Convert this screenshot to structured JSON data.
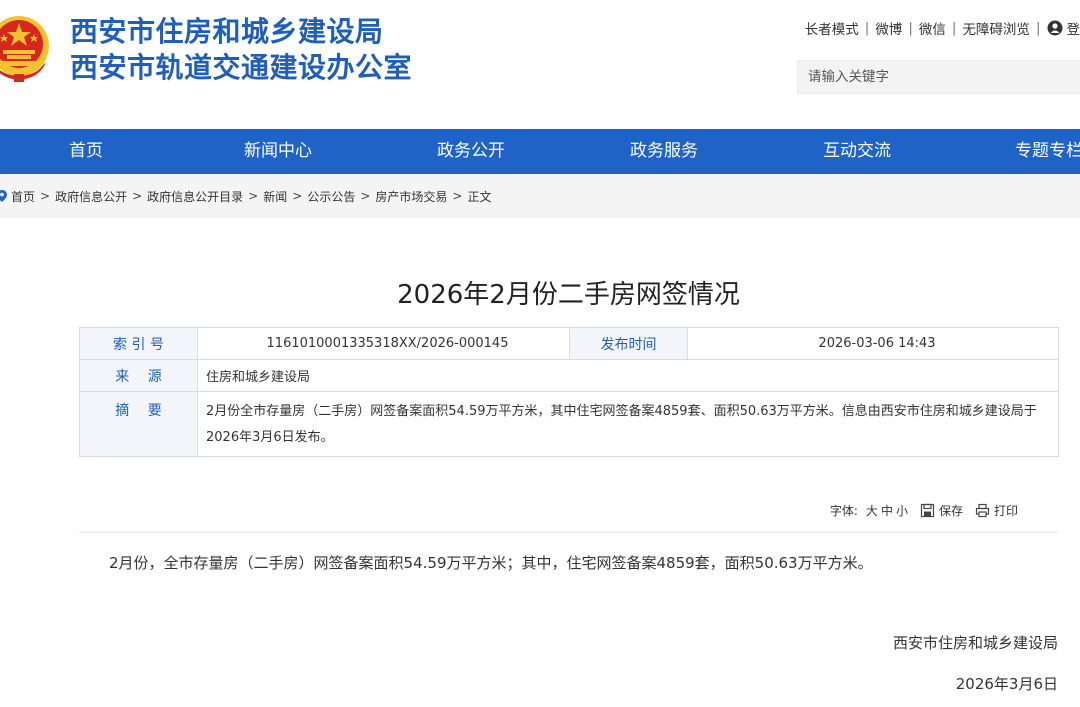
{
  "header": {
    "title_line1": "西安市住房和城乡建设局",
    "title_line2": "西安市轨道交通建设办公室",
    "top_links": [
      "长者模式",
      "微博",
      "微信",
      "无障碍浏览"
    ],
    "login_label": "登",
    "search_placeholder": "请输入关键字"
  },
  "nav": {
    "items": [
      "首页",
      "新闻中心",
      "政务公开",
      "政务服务",
      "互动交流",
      "专题专栏"
    ]
  },
  "breadcrumb": {
    "items": [
      "首页",
      "政府信息公开",
      "政府信息公开目录",
      "新闻",
      "公示公告",
      "房产市场交易",
      "正文"
    ],
    "separator": ">"
  },
  "article": {
    "title": "2026年2月份二手房网签情况",
    "meta": {
      "index_label": "索 引 号",
      "index_value": "1161010001335318XX/2026-000145",
      "publish_label": "发布时间",
      "publish_value": "2026-03-06 14:43",
      "source_label": "来　 源",
      "source_value": "住房和城乡建设局",
      "summary_label": "摘　 要",
      "summary_value": "2月份全市存量房（二手房）网签备案面积54.59万平方米，其中住宅网签备案4859套、面积50.63万平方米。信息由西安市住房和城乡建设局于2026年3月6日发布。"
    },
    "tools": {
      "font_label": "字体:",
      "font_sizes": [
        "大",
        "中",
        "小"
      ],
      "save_label": "保存",
      "print_label": "打印"
    },
    "body": "2月份，全市存量房（二手房）网签备案面积54.59万平方米；其中，住宅网签备案4859套，面积50.63万平方米。",
    "signature_org": "西安市住房和城乡建设局",
    "signature_date": "2026年3月6日"
  },
  "colors": {
    "brand_blue": "#1f63c6",
    "title_blue": "#1f5fb9",
    "emblem_red": "#d7261d",
    "emblem_gold": "#f2c230"
  }
}
